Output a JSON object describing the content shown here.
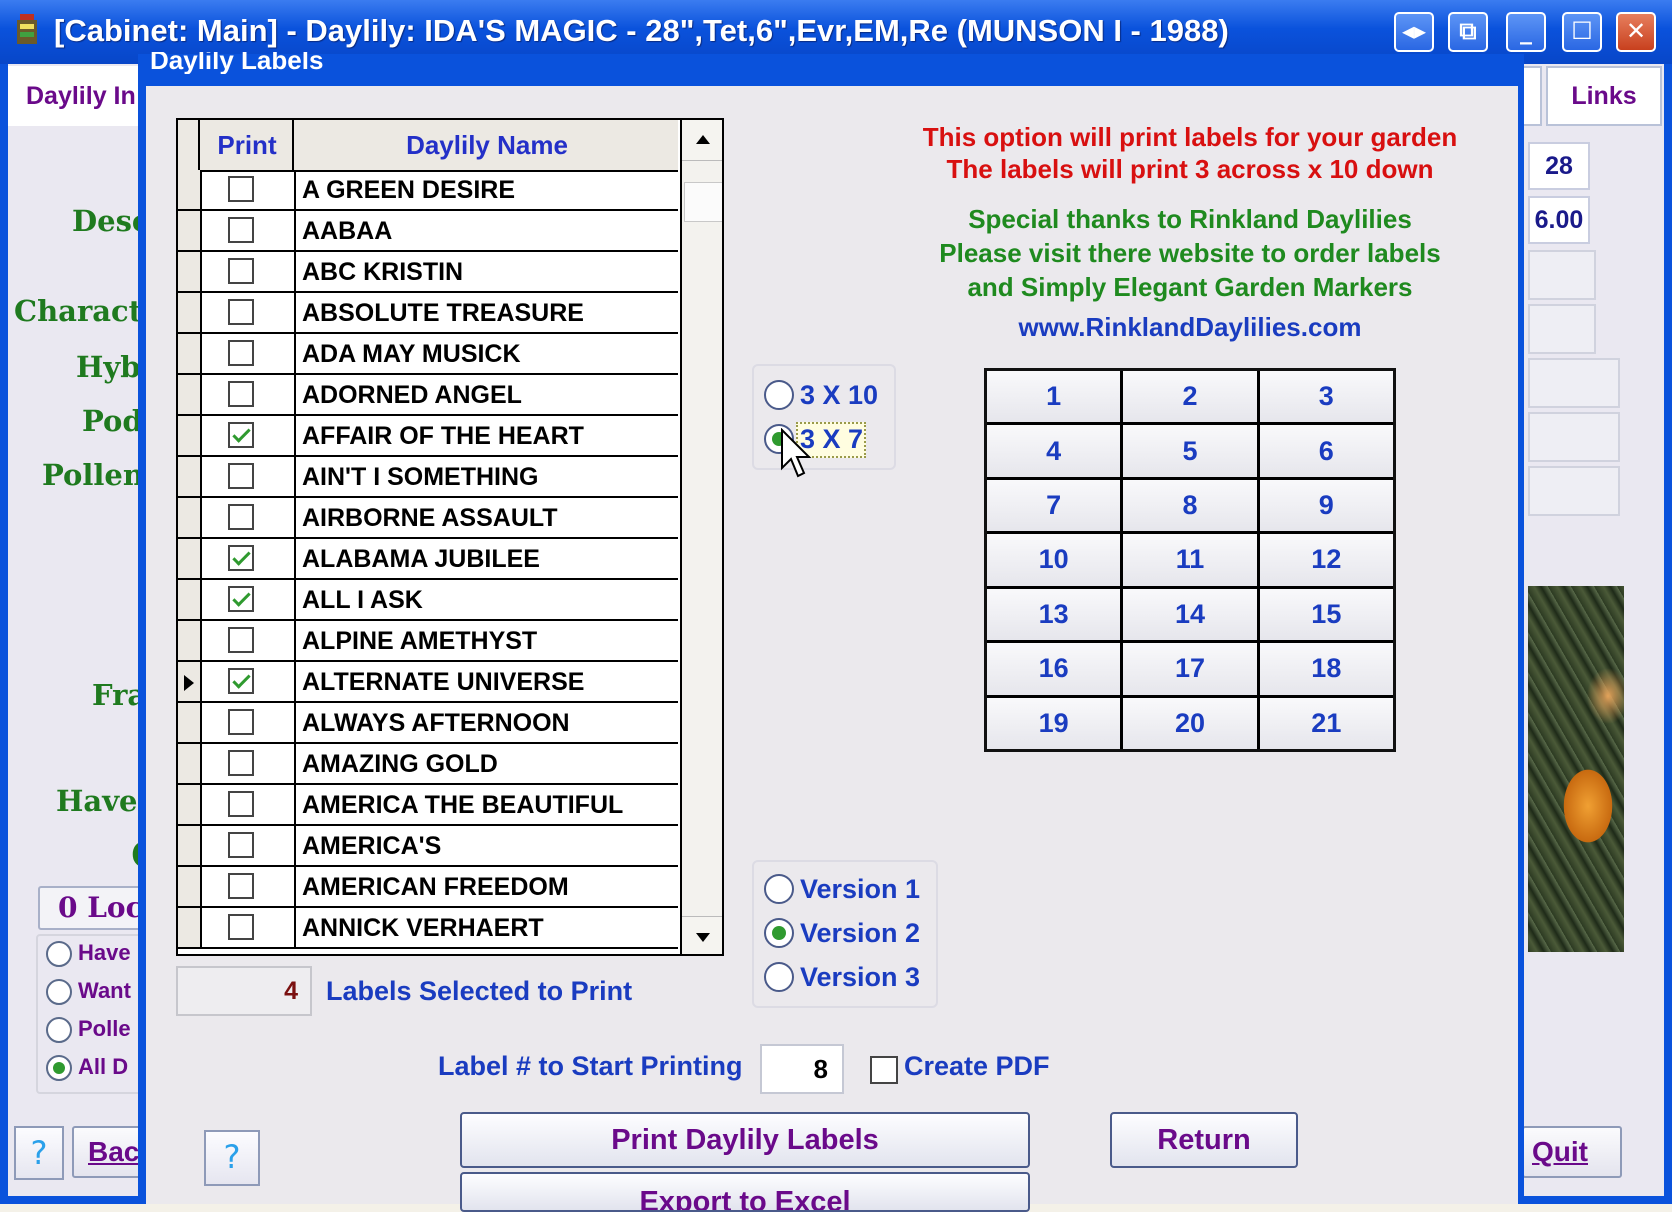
{
  "window": {
    "title": "[Cabinet: Main] - Daylily: IDA'S MAGIC - 28\",Tet,6\",Evr,EM,Re (MUNSON I - 1988)",
    "controls": [
      "◂▸",
      "⧉",
      "_",
      "☐",
      "✕"
    ]
  },
  "background": {
    "tab_left": "Daylily In",
    "tab_right": "Links",
    "labels": [
      "Desc",
      "Charact",
      "Hyb",
      "Pod",
      "Pollen",
      "Fra",
      "Have",
      "("
    ],
    "field_values": [
      "28",
      "6.00"
    ],
    "locations_button": "0 Loc",
    "filter_options": [
      {
        "label": "Have",
        "selected": false
      },
      {
        "label": "Want",
        "selected": false
      },
      {
        "label": "Polle",
        "selected": false
      },
      {
        "label": "All D",
        "selected": true
      }
    ],
    "back_button": "Bac",
    "quit_button": "Quit",
    "help_button": "?"
  },
  "dialog": {
    "title": "Daylily Labels",
    "grid": {
      "headers": {
        "print": "Print",
        "name": "Daylily Name"
      },
      "rows": [
        {
          "name": "A GREEN DESIRE",
          "checked": false
        },
        {
          "name": "AABAA",
          "checked": false
        },
        {
          "name": "ABC KRISTIN",
          "checked": false
        },
        {
          "name": "ABSOLUTE TREASURE",
          "checked": false
        },
        {
          "name": "ADA MAY MUSICK",
          "checked": false
        },
        {
          "name": "ADORNED ANGEL",
          "checked": false
        },
        {
          "name": "AFFAIR OF THE HEART",
          "checked": true
        },
        {
          "name": "AIN'T I SOMETHING",
          "checked": false
        },
        {
          "name": "AIRBORNE ASSAULT",
          "checked": false
        },
        {
          "name": "ALABAMA JUBILEE",
          "checked": true
        },
        {
          "name": "ALL I ASK",
          "checked": true
        },
        {
          "name": "ALPINE AMETHYST",
          "checked": false
        },
        {
          "name": "ALTERNATE UNIVERSE",
          "checked": true,
          "current": true
        },
        {
          "name": "ALWAYS AFTERNOON",
          "checked": false
        },
        {
          "name": "AMAZING GOLD",
          "checked": false
        },
        {
          "name": "AMERICA THE BEAUTIFUL",
          "checked": false
        },
        {
          "name": "AMERICA'S",
          "checked": false
        },
        {
          "name": "AMERICAN FREEDOM",
          "checked": false
        },
        {
          "name": "ANNICK VERHAERT",
          "checked": false
        }
      ]
    },
    "selected_count": "4",
    "selected_label": "Labels Selected to Print",
    "layout_options": [
      {
        "label": "3 X 10",
        "selected": false
      },
      {
        "label": "3 X 7",
        "selected": true
      }
    ],
    "version_options": [
      {
        "label": "Version 1",
        "selected": false
      },
      {
        "label": "Version 2",
        "selected": true
      },
      {
        "label": "Version 3",
        "selected": false
      }
    ],
    "info_red": [
      "This option will print labels for your garden",
      "The labels will print 3 across x 10 down"
    ],
    "info_green": [
      "Special thanks to Rinkland Daylilies",
      "Please visit there website to order labels",
      "and Simply Elegant Garden Markers"
    ],
    "website": "www.RinklandDaylilies.com",
    "label_numbers": [
      "1",
      "2",
      "3",
      "4",
      "5",
      "6",
      "7",
      "8",
      "9",
      "10",
      "11",
      "12",
      "13",
      "14",
      "15",
      "16",
      "17",
      "18",
      "19",
      "20",
      "21"
    ],
    "start_label_text": "Label # to Start Printing",
    "start_label_value": "8",
    "create_pdf_label": "Create PDF",
    "create_pdf_checked": false,
    "print_button": "Print Daylily Labels",
    "export_button": "Export to Excel",
    "return_button": "Return",
    "help_button": "?"
  },
  "colors": {
    "titlebar": "#0a52dc",
    "red_text": "#d81010",
    "green_text": "#1f8a1f",
    "blue_text": "#1a3cc0",
    "purple_text": "#6a0a8a"
  }
}
